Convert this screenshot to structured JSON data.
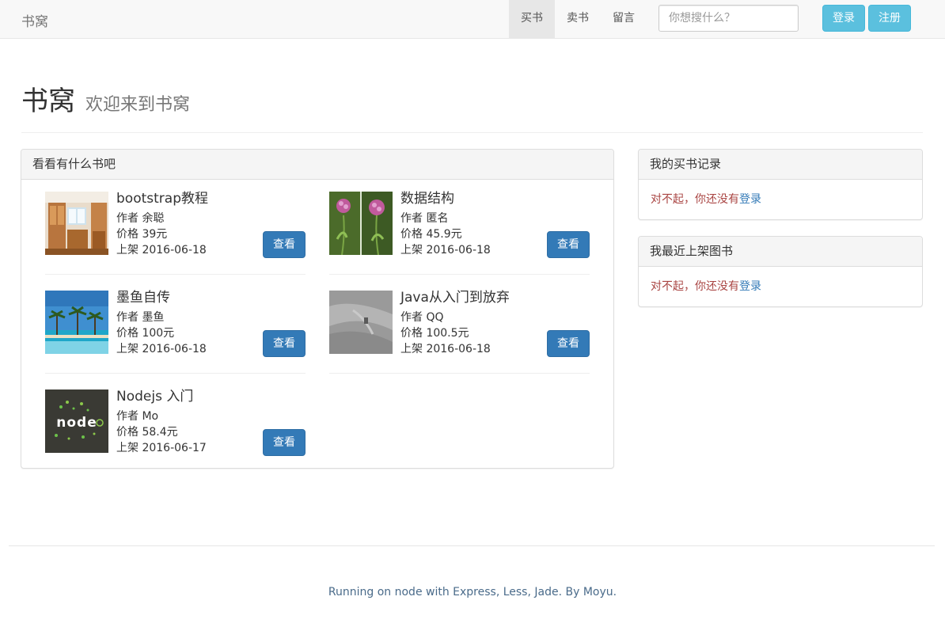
{
  "navbar": {
    "brand": "书窝",
    "items": [
      {
        "label": "买书",
        "active": true
      },
      {
        "label": "卖书",
        "active": false
      },
      {
        "label": "留言",
        "active": false
      }
    ],
    "search_placeholder": "你想搜什么？",
    "login_label": "登录",
    "register_label": "注册"
  },
  "header": {
    "title": "书窝",
    "subtitle": "欢迎来到书窝"
  },
  "books_panel": {
    "heading": "看看有什么书吧",
    "view_label": "查看",
    "books": [
      {
        "title": "bootstrap教程",
        "author": "作者 余聪",
        "price": "价格 39元",
        "date": "上架 2016-06-18",
        "thumb": "room-interior"
      },
      {
        "title": "数据结构",
        "author": "作者 匿名",
        "price": "价格 45.9元",
        "date": "上架 2016-06-18",
        "thumb": "purple-flowers"
      },
      {
        "title": "墨鱼自传",
        "author": "作者 墨鱼",
        "price": "价格 100元",
        "date": "上架 2016-06-18",
        "thumb": "palm-beach"
      },
      {
        "title": "Java从入门到放弃",
        "author": "作者 QQ",
        "price": "价格 100.5元",
        "date": "上架 2016-06-18",
        "thumb": "grey-texture"
      },
      {
        "title": "Nodejs 入门",
        "author": "作者 Mo",
        "price": "价格 58.4元",
        "date": "上架 2016-06-17",
        "thumb": "nodejs-logo"
      }
    ]
  },
  "records_panel": {
    "heading": "我的买书记录",
    "message": "对不起，你还没有",
    "link": "登录"
  },
  "recent_panel": {
    "heading": "我最近上架图书",
    "message": "对不起，你还没有",
    "link": "登录"
  },
  "footer": {
    "text": "Running on node with Express, Less, Jade. By Moyu."
  },
  "colors": {
    "primary": "#337ab7",
    "info": "#5bc0de",
    "danger_text": "#a94442"
  }
}
